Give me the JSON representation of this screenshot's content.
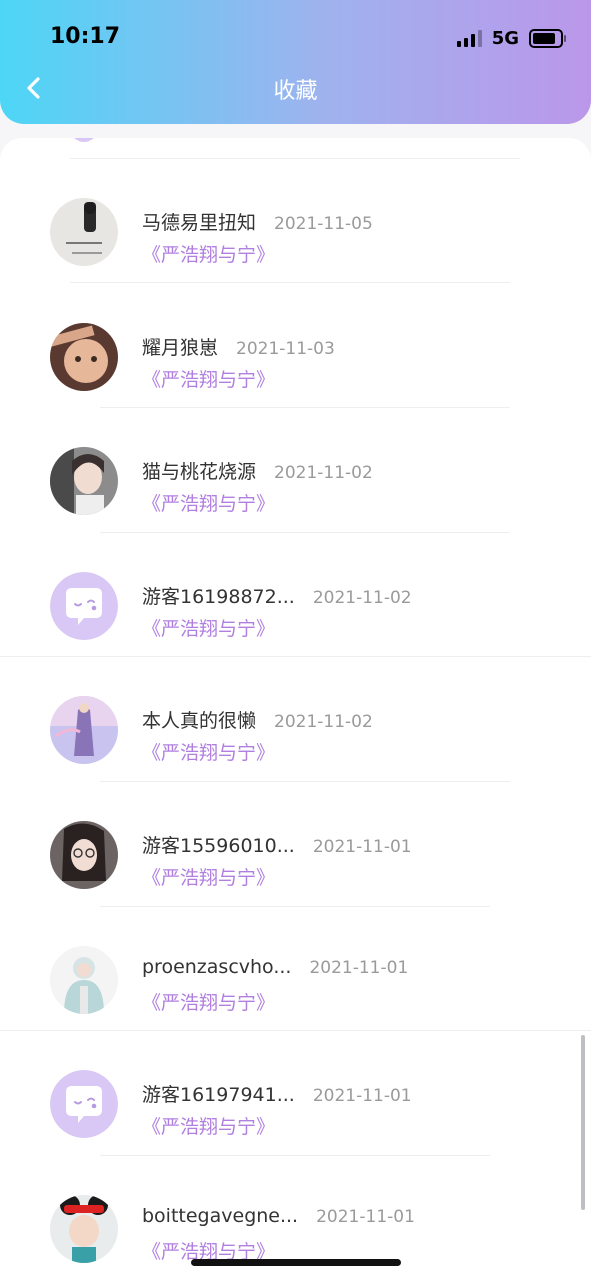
{
  "status_bar": {
    "time": "10:17",
    "network": "5G"
  },
  "header": {
    "title": "收藏"
  },
  "colors": {
    "gradient_start": "#4dd6f6",
    "gradient_end": "#bb97ea",
    "book_title": "#b07fe0",
    "default_avatar": "#d9c8f5"
  },
  "items": [
    {
      "name": "马德易里扭知",
      "date": "2021-11-05",
      "book": "《严浩翔与宁》",
      "avatar": "photo-avatar"
    },
    {
      "name": "耀月狼崽",
      "date": "2021-11-03",
      "book": "《严浩翔与宁》",
      "avatar": "photo-avatar"
    },
    {
      "name": "猫与桃花烧源",
      "date": "2021-11-02",
      "book": "《严浩翔与宁》",
      "avatar": "photo-avatar"
    },
    {
      "name": "游客16198872...",
      "date": "2021-11-02",
      "book": "《严浩翔与宁》",
      "avatar": "default-chat-avatar"
    },
    {
      "name": "本人真的很懒",
      "date": "2021-11-02",
      "book": "《严浩翔与宁》",
      "avatar": "photo-avatar"
    },
    {
      "name": "游客15596010...",
      "date": "2021-11-01",
      "book": "《严浩翔与宁》",
      "avatar": "photo-avatar"
    },
    {
      "name": "proenzascvho...",
      "date": "2021-11-01",
      "book": "《严浩翔与宁》",
      "avatar": "photo-avatar"
    },
    {
      "name": "游客16197941...",
      "date": "2021-11-01",
      "book": "《严浩翔与宁》",
      "avatar": "default-chat-avatar"
    },
    {
      "name": "boittegavegne...",
      "date": "2021-11-01",
      "book": "《严浩翔与宁》",
      "avatar": "photo-avatar"
    }
  ]
}
